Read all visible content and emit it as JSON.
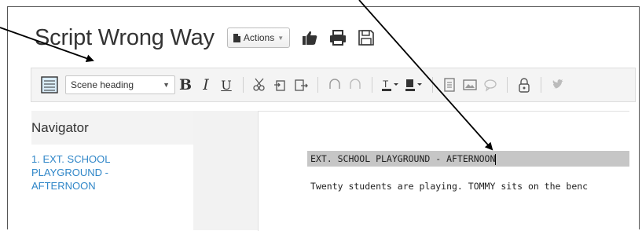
{
  "app": {
    "title": "Script Wrong Way"
  },
  "title_actions": {
    "actions_label": "Actions"
  },
  "toolbar": {
    "element_style": "Scene heading"
  },
  "navigator": {
    "heading": "Navigator",
    "items": [
      {
        "label": "1. EXT. SCHOOL PLAYGROUND - AFTERNOON"
      }
    ]
  },
  "editor": {
    "scene_heading": "EXT. SCHOOL PLAYGROUND - AFTERNOON",
    "action_text": "Twenty students are playing. TOMMY sits on the benc"
  },
  "colors": {
    "link_blue": "#2f86c8",
    "selection_gray": "#c6c6c6",
    "toolbar_bg": "#f4f4f4"
  }
}
